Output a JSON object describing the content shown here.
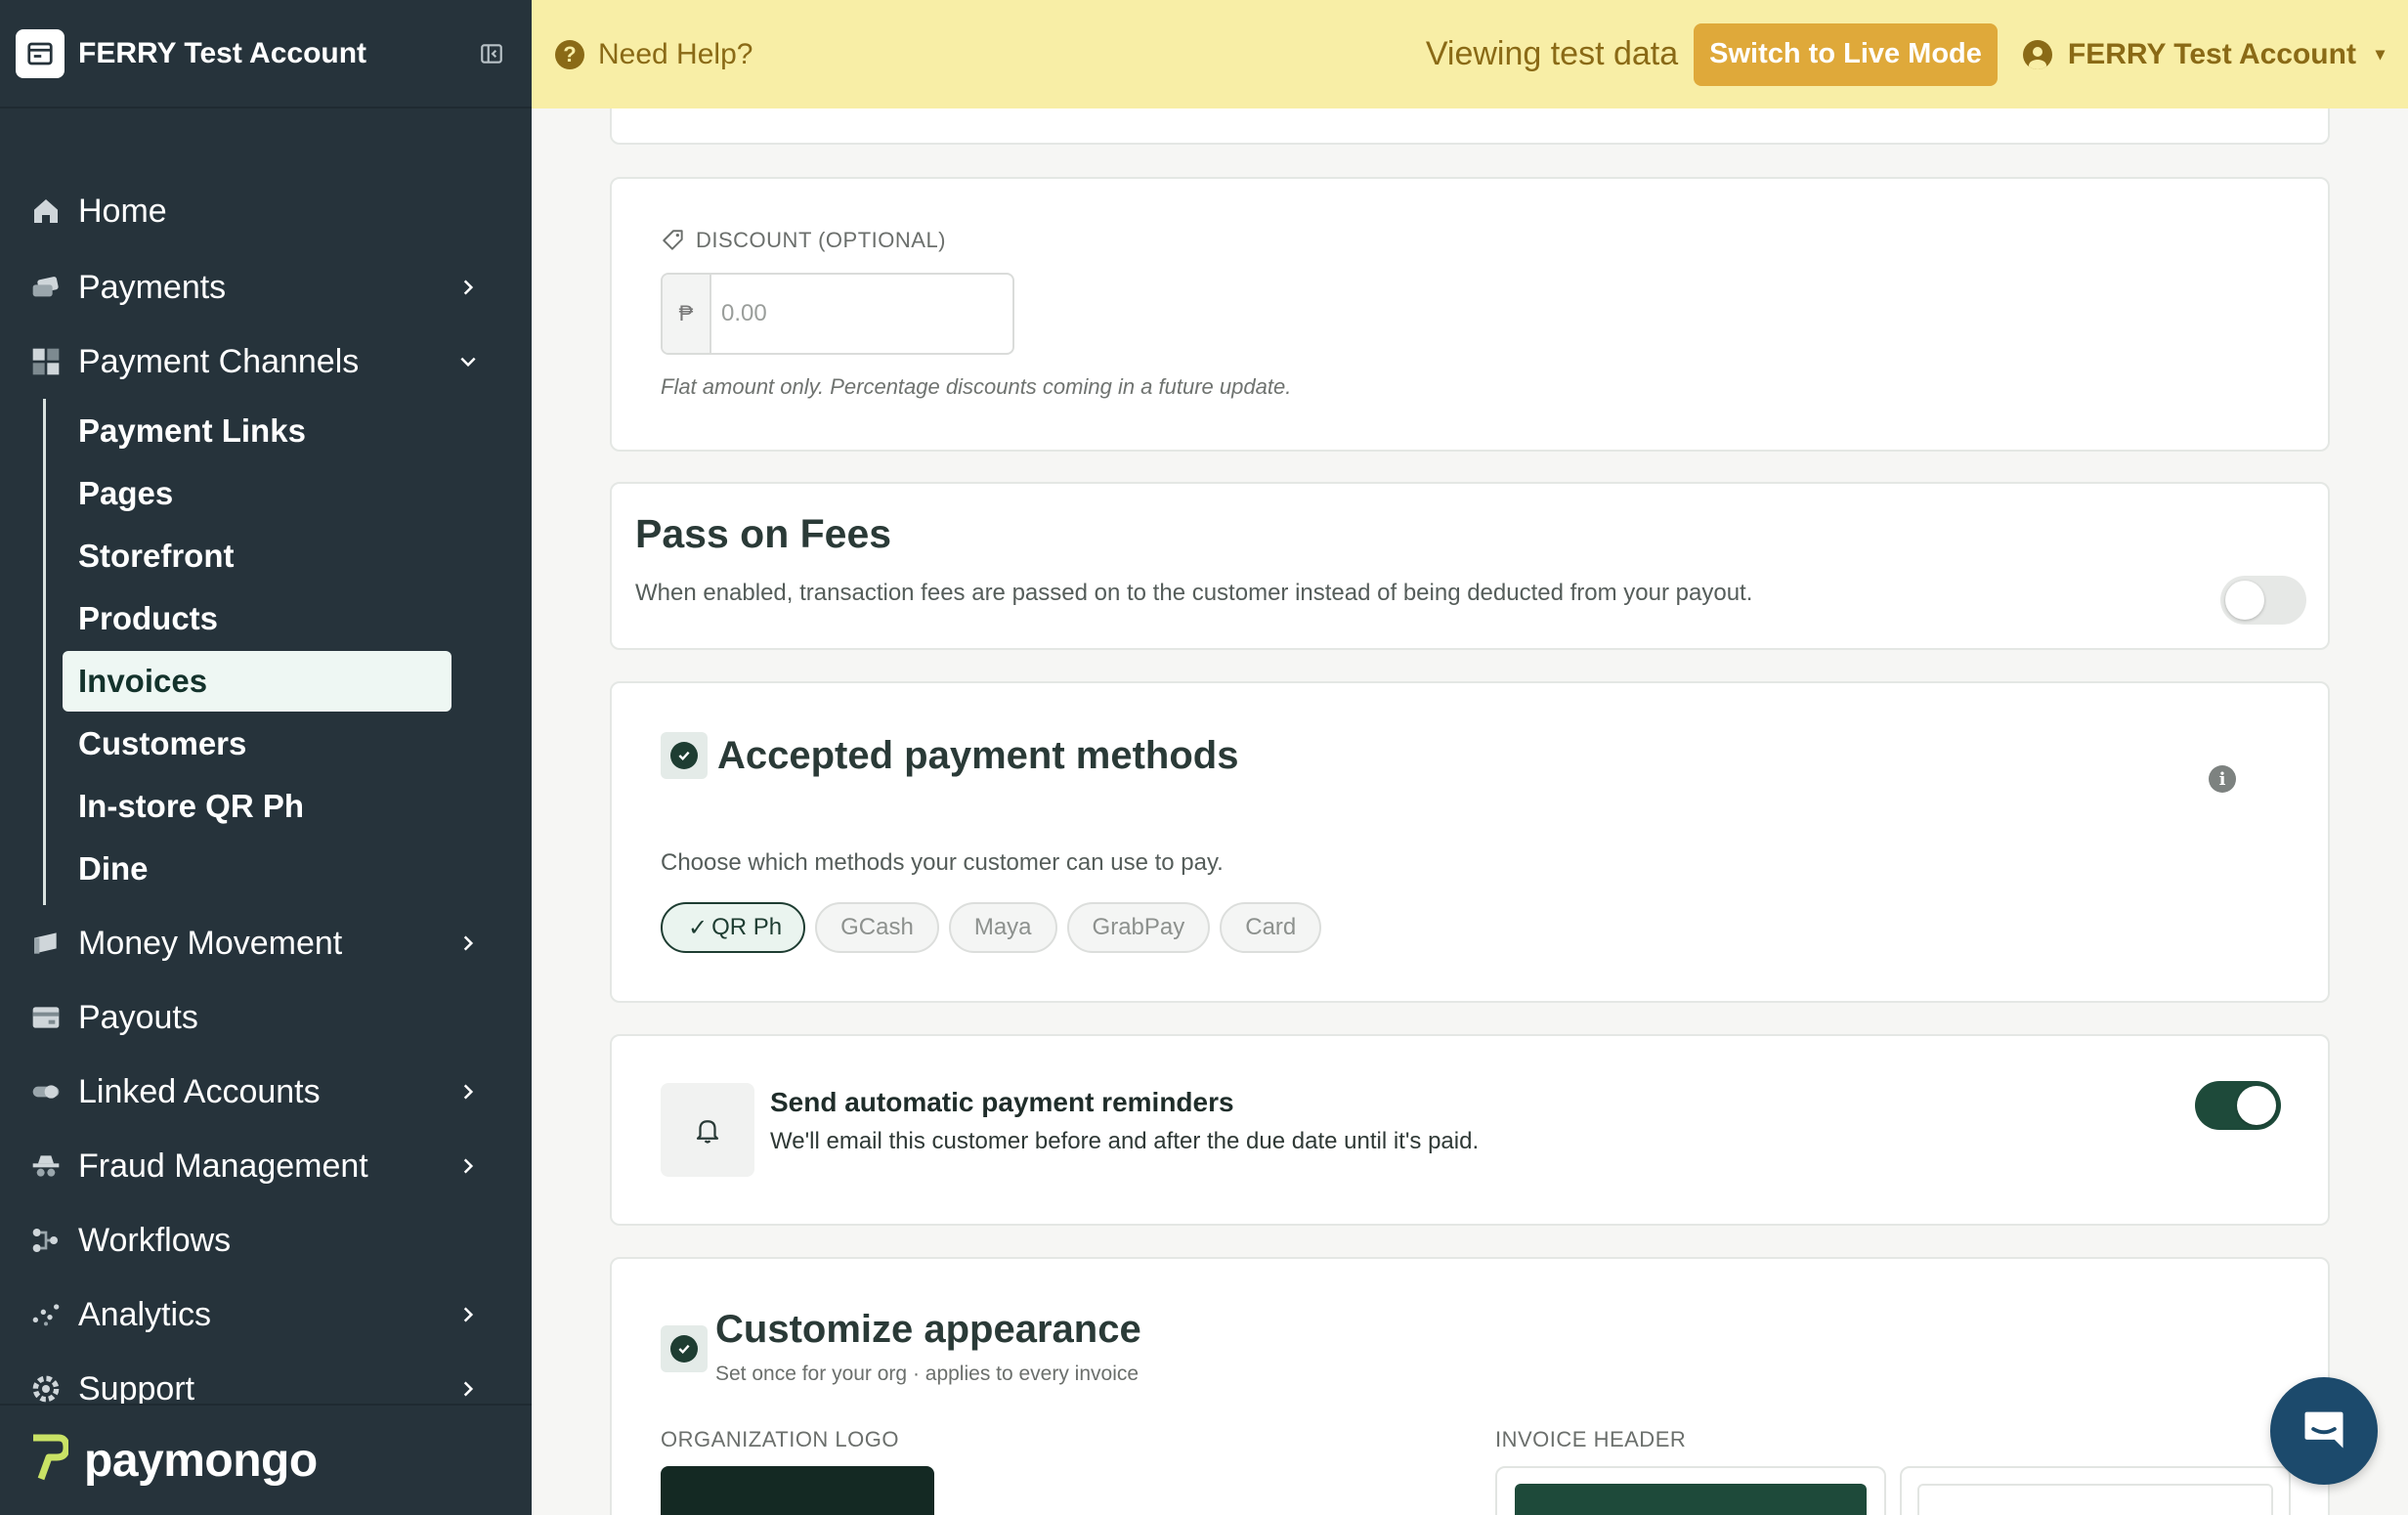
{
  "sidebar": {
    "title": "FERRY Test Account",
    "items": [
      {
        "label": "Home",
        "has_chevron": false
      },
      {
        "label": "Payments",
        "has_chevron": true
      },
      {
        "label": "Payment Channels",
        "has_chevron": true,
        "expanded": true
      },
      {
        "label": "Money Movement",
        "has_chevron": true
      },
      {
        "label": "Payouts",
        "has_chevron": false
      },
      {
        "label": "Linked Accounts",
        "has_chevron": true
      },
      {
        "label": "Fraud Management",
        "has_chevron": true
      },
      {
        "label": "Workflows",
        "has_chevron": false
      },
      {
        "label": "Analytics",
        "has_chevron": true
      },
      {
        "label": "Support",
        "has_chevron": true
      }
    ],
    "sub_items": [
      "Payment Links",
      "Pages",
      "Storefront",
      "Products",
      "Invoices",
      "Customers",
      "In-store QR Ph",
      "Dine"
    ],
    "active_sub_item": "Invoices",
    "brand": "paymongo"
  },
  "topbar": {
    "help": "Need Help?",
    "viewing": "Viewing test data",
    "live_button": "Switch to Live Mode",
    "account": "FERRY Test Account"
  },
  "discount": {
    "label": "DISCOUNT (OPTIONAL)",
    "currency": "₱",
    "placeholder": "0.00",
    "help": "Flat amount only. Percentage discounts coming in a future update."
  },
  "fees": {
    "title": "Pass on Fees",
    "description": "When enabled, transaction fees are passed on to the customer instead of being deducted from your payout.",
    "enabled": false
  },
  "methods": {
    "title": "Accepted payment methods",
    "description": "Choose which methods your customer can use to pay.",
    "options": [
      {
        "label": "QR Ph",
        "selected": true
      },
      {
        "label": "GCash",
        "selected": false
      },
      {
        "label": "Maya",
        "selected": false
      },
      {
        "label": "GrabPay",
        "selected": false
      },
      {
        "label": "Card",
        "selected": false
      }
    ]
  },
  "reminders": {
    "title": "Send automatic payment reminders",
    "description": "We'll email this customer before and after the due date until it's paid.",
    "enabled": true
  },
  "appearance": {
    "title": "Customize appearance",
    "subtitle": "Set once for your org · applies to every invoice",
    "logo_label": "ORGANIZATION LOGO",
    "header_label": "INVOICE HEADER"
  },
  "colors": {
    "sidebar_bg": "#26333b",
    "banner_bg": "#f8eea6",
    "accent_gold": "#dfa93a",
    "brand_green": "#1e3d32",
    "brand_lime": "#c9e265"
  }
}
